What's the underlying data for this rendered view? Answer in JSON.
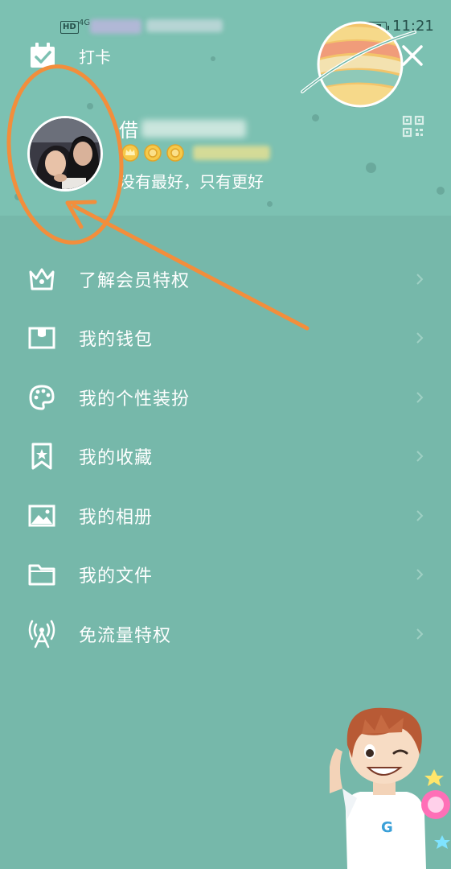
{
  "status_bar": {
    "network_badge": "HD",
    "network_type": "4G",
    "time": "11:21",
    "battery_level": 0.85
  },
  "header": {
    "checkin_label": "打卡",
    "user_name_visible": "借",
    "signature": "没有最好，只有更好",
    "background_color": "#7cc1b2"
  },
  "menu": {
    "items": [
      {
        "label": "了解会员特权",
        "icon": "crown-icon"
      },
      {
        "label": "我的钱包",
        "icon": "wallet-icon"
      },
      {
        "label": "我的个性装扮",
        "icon": "palette-icon"
      },
      {
        "label": "我的收藏",
        "icon": "bookmark-star-icon"
      },
      {
        "label": "我的相册",
        "icon": "photo-icon"
      },
      {
        "label": "我的文件",
        "icon": "folder-icon"
      },
      {
        "label": "免流量特权",
        "icon": "antenna-icon"
      }
    ]
  },
  "colors": {
    "menu_background": "#76b8aa",
    "annotation_orange": "#f28e3c"
  }
}
